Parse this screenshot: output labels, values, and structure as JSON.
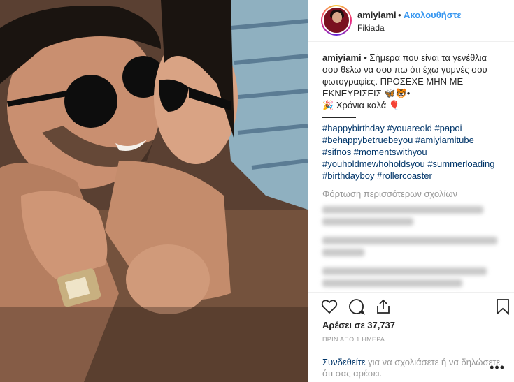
{
  "post": {
    "username": "amiyiami",
    "follow_separator": "•",
    "follow_label": "Ακολουθήστε",
    "location": "Fikiada"
  },
  "caption": {
    "username": "amiyiami",
    "text": " • Σήμερα που είναι τα γενέθλια σου θέλω να σου πω ότι έχω γυμνές σου φωτογραφίες. ΠΡΟΣΕΧΕ ΜΗΝ ΜΕ ΕΚΝΕΥΡΙΣΕΙΣ 🦋🐯•",
    "wish": "🎉 Χρόνια καλά 🎈",
    "hashtags": "#happybirthday #youareold #papoi #behappybetruebeyou #amiyiamitube #sifnos #momentswithyou #youholdmewhoholdsyou #summerloading #birthdayboy #rollercoaster"
  },
  "load_more": "Φόρτωση περισσότερων σχολίων",
  "likes": "Αρέσει σε 37,737",
  "timestamp": "ΠΡΙΝ ΑΠΟ 1 ΗΜΕΡΑ",
  "footer": {
    "login_link": "Συνδεθείτε",
    "login_text": " για να σχολιάσετε ή να δηλώσετε ότι σας αρέσει.",
    "more_label": "•••"
  },
  "icons": {
    "like": "heart-icon",
    "comment": "comment-icon",
    "share": "share-icon",
    "save": "bookmark-icon"
  }
}
